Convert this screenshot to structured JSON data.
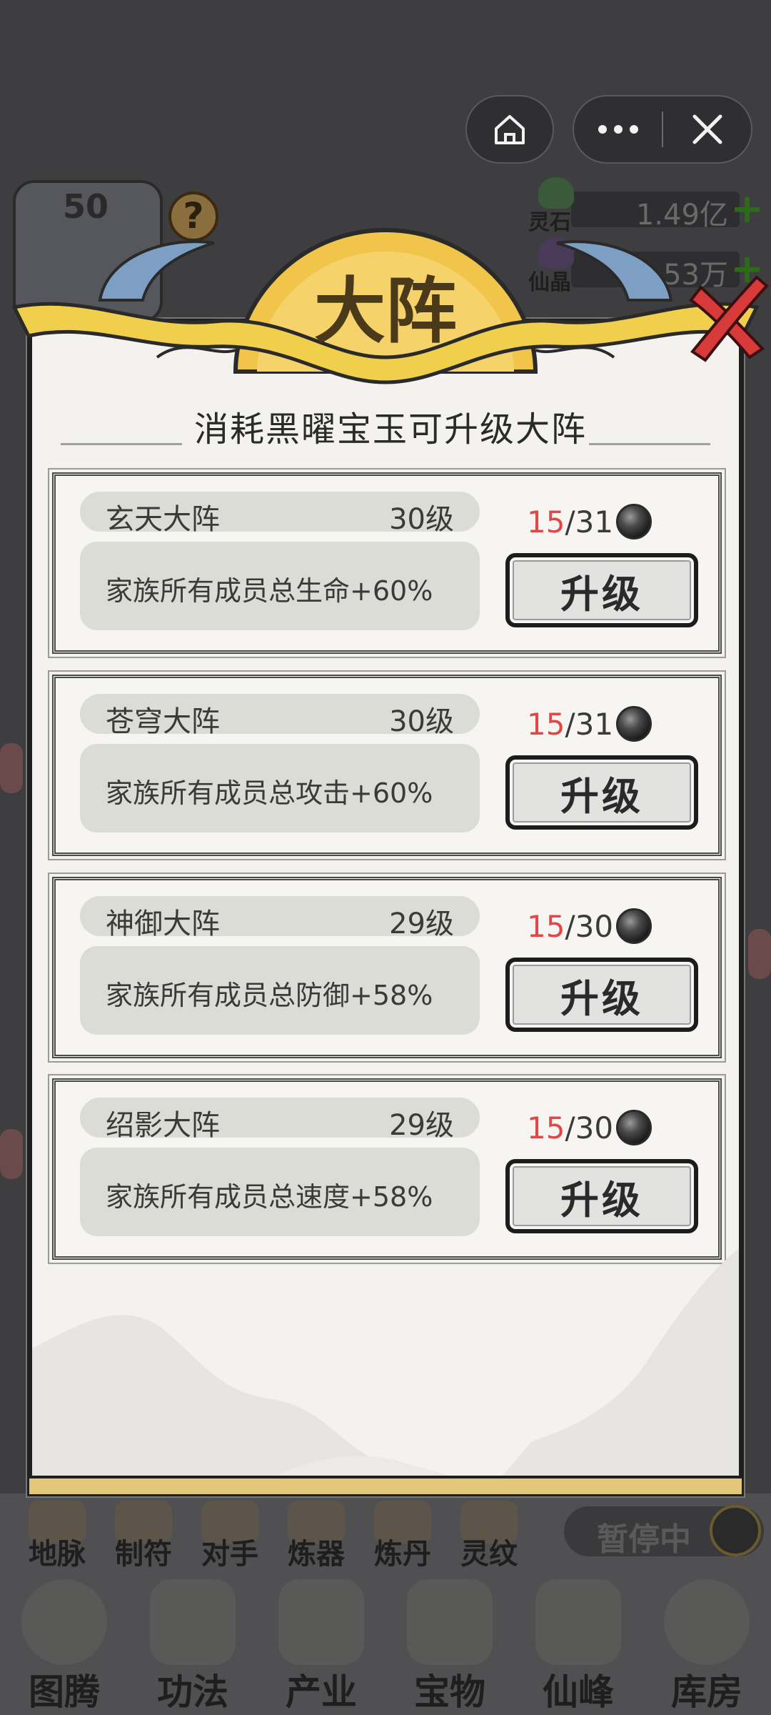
{
  "capsule": {
    "home_icon": "home-icon",
    "more_icon": "more-dots-icon",
    "close_icon": "close-icon"
  },
  "background": {
    "player_level": "50",
    "help_glyph": "?",
    "resources": [
      {
        "name": "灵石",
        "value": "1.49亿",
        "plus": "+"
      },
      {
        "name": "仙晶",
        "value": "4.53万",
        "plus": "+"
      }
    ],
    "small_nav": [
      "地脉",
      "制符",
      "对手",
      "炼器",
      "炼丹",
      "灵纹"
    ],
    "pause_label": "暂停中",
    "main_nav": [
      "图腾",
      "功法",
      "产业",
      "宝物",
      "仙峰",
      "库房"
    ]
  },
  "modal": {
    "title": "大阵",
    "subtitle": "消耗黑曜宝玉可升级大阵",
    "upgrade_label": "升级",
    "arrays": [
      {
        "name": "玄天大阵",
        "level": "30级",
        "effect": "家族所有成员总生命+60%",
        "have": "15",
        "need": "/31"
      },
      {
        "name": "苍穹大阵",
        "level": "30级",
        "effect": "家族所有成员总攻击+60%",
        "have": "15",
        "need": "/31"
      },
      {
        "name": "神御大阵",
        "level": "29级",
        "effect": "家族所有成员总防御+58%",
        "have": "15",
        "need": "/30"
      },
      {
        "name": "绍影大阵",
        "level": "29级",
        "effect": "家族所有成员总速度+58%",
        "have": "15",
        "need": "/30"
      }
    ]
  },
  "colors": {
    "accent_red": "#e04848",
    "banner_gold": "#f1c54a",
    "close_red": "#d83a3a"
  }
}
